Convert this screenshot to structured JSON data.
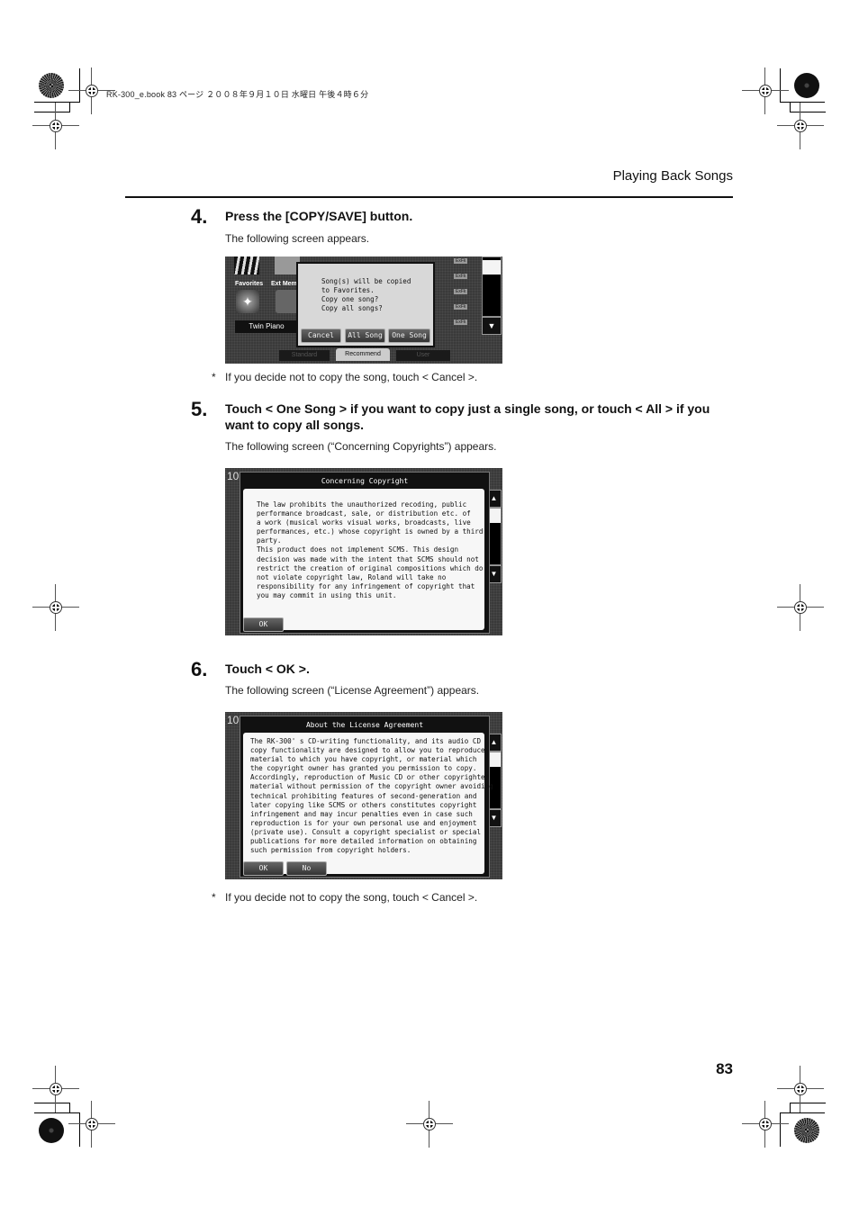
{
  "print_meta": "RK-300_e.book  83 ページ  ２００８年９月１０日  水曜日  午後４時６分",
  "running_head": "Playing Back Songs",
  "page_number": "83",
  "steps": [
    {
      "number": "4.",
      "title": "Press the [COPY/SAVE] button.",
      "body": "The following screen appears.",
      "note": "If you decide not to copy the song, touch < Cancel >.",
      "screen": {
        "background_labels": [
          "Favorites",
          "Ext Memo"
        ],
        "tone_name": "Twin Piano",
        "dialog_lines": [
          "Song(s) will be copied",
          "to Favorites.",
          "Copy one song?",
          "Copy all songs?"
        ],
        "buttons": [
          "Cancel",
          "All Song",
          "One Song"
        ],
        "tabs": [
          "Standard",
          "Recommend",
          "User"
        ],
        "active_tab": "Recommend",
        "side_badges": [
          "ExFk",
          "ExFk",
          "ExFk",
          "ExFk",
          "ExFk"
        ]
      }
    },
    {
      "number": "5.",
      "title": "Touch < One Song > if you want to copy just a single song, or touch < All > if you want to copy all songs.",
      "body": "The following screen (“Concerning Copyrights”) appears.",
      "screen": {
        "dialog_title": "Concerning Copyright",
        "dialog_text": "The law prohibits the unauthorized recoding, public\nperformance broadcast, sale, or distribution etc. of\na work (musical works visual works, broadcasts, live\nperformances, etc.) whose copyright is owned by a third\nparty.\nThis product does not implement SCMS. This design\ndecision was made with the intent that SCMS should not\nrestrict the creation of original compositions which do\nnot violate copyright law, Roland will take no\nresponsibility for any infringement of copyright that\nyou may commit in using this unit.",
        "buttons": [
          "OK"
        ]
      }
    },
    {
      "number": "6.",
      "title": "Touch < OK >.",
      "body": "The following screen (“License Agreement”) appears.",
      "note": "If you decide not to copy the song, touch < Cancel >.",
      "screen": {
        "dialog_title": "About the License Agreement",
        "dialog_text": "The RK-300' s CD-writing functionality, and its audio CD\ncopy functionality are designed to allow you to reproduce\nmaterial to which you have copyright, or material which\nthe copyright owner has granted you permission to copy.\nAccordingly, reproduction of Music CD or other copyrighted\nmaterial without permission of the copyright owner avoiding\ntechnical prohibiting features of second-generation and\nlater copying like SCMS or others constitutes copyright\ninfringement and may incur penalties even in case such\nreproduction is for your own personal use and enjoyment\n(private use). Consult a copyright specialist or special\npublications for more detailed information on obtaining\nsuch permission from copyright holders.",
        "buttons": [
          "OK",
          "No"
        ]
      }
    }
  ],
  "note_marker": "*"
}
